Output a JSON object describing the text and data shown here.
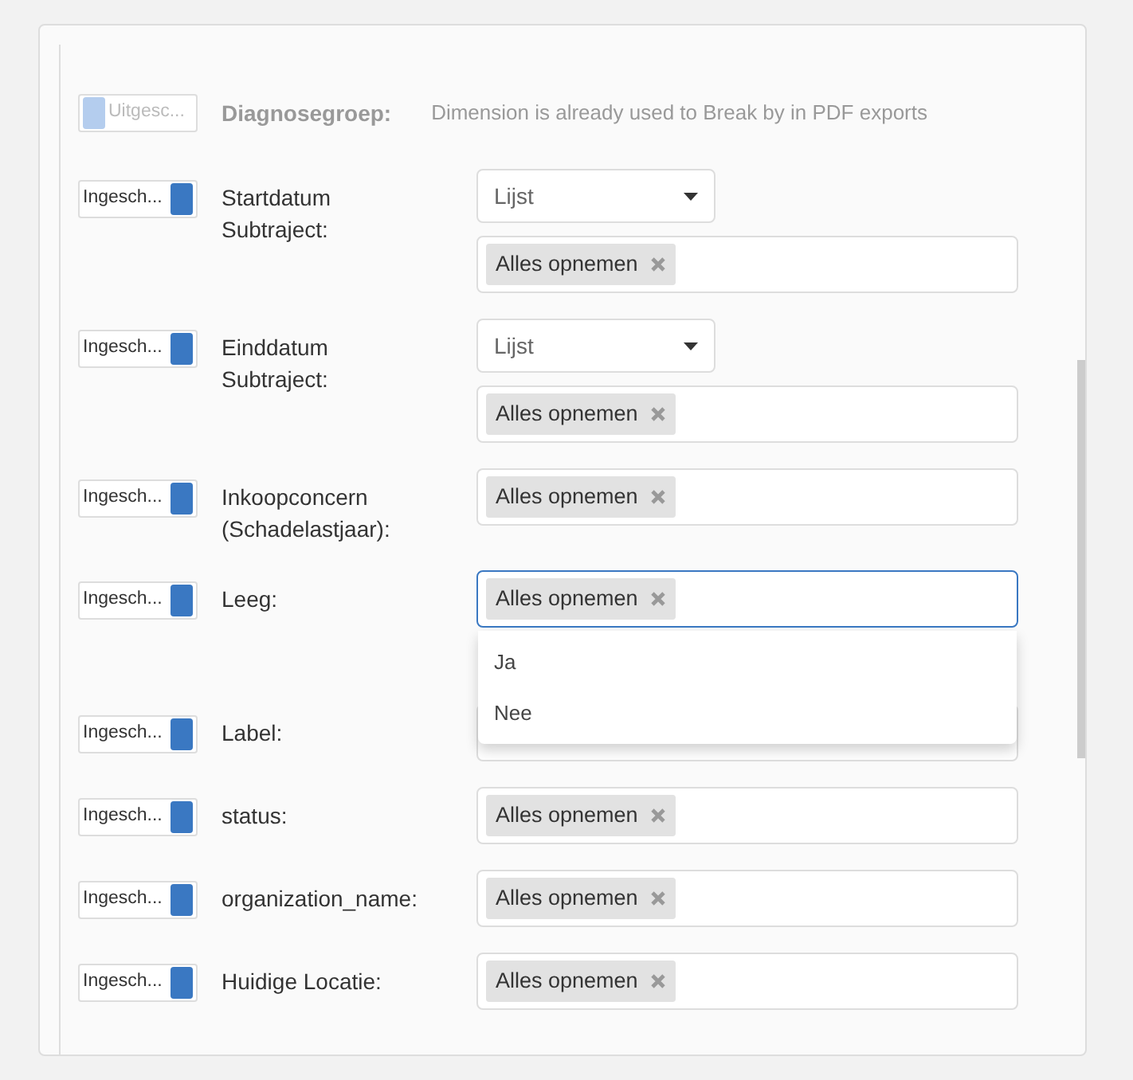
{
  "rows": [
    {
      "toggle": {
        "text": "Uitgesc...",
        "on": false
      },
      "label": "Diagnosegroep:",
      "disabled": true,
      "note": "Dimension is already used to Break by in PDF exports"
    },
    {
      "toggle": {
        "text": "Ingesch...",
        "on": true
      },
      "label": "Startdatum Subtraject:",
      "disabled": false,
      "controls": [
        {
          "kind": "select",
          "value": "Lijst"
        },
        {
          "kind": "tags",
          "tags": [
            "Alles opnemen"
          ],
          "focused": false
        }
      ]
    },
    {
      "toggle": {
        "text": "Ingesch...",
        "on": true
      },
      "label": "Einddatum Subtraject:",
      "disabled": false,
      "controls": [
        {
          "kind": "select",
          "value": "Lijst"
        },
        {
          "kind": "tags",
          "tags": [
            "Alles opnemen"
          ],
          "focused": false
        }
      ]
    },
    {
      "toggle": {
        "text": "Ingesch...",
        "on": true
      },
      "label": "Inkoopconcern (Schadelastjaar):",
      "disabled": false,
      "controls": [
        {
          "kind": "tags",
          "tags": [
            "Alles opnemen"
          ],
          "focused": false
        }
      ]
    },
    {
      "toggle": {
        "text": "Ingesch...",
        "on": true
      },
      "label": "Leeg:",
      "disabled": false,
      "controls": [
        {
          "kind": "tags",
          "tags": [
            "Alles opnemen"
          ],
          "focused": true,
          "options": [
            "Ja",
            "Nee"
          ]
        }
      ]
    },
    {
      "toggle": {
        "text": "Ingesch...",
        "on": true
      },
      "label": "Label:",
      "disabled": false,
      "controls": [
        {
          "kind": "tags",
          "focused": false
        }
      ]
    },
    {
      "toggle": {
        "text": "Ingesch...",
        "on": true
      },
      "label": "status:",
      "disabled": false,
      "controls": [
        {
          "kind": "tags",
          "tags": [
            "Alles opnemen"
          ],
          "focused": false
        }
      ]
    },
    {
      "toggle": {
        "text": "Ingesch...",
        "on": true
      },
      "label": "organization_name:",
      "disabled": false,
      "controls": [
        {
          "kind": "tags",
          "tags": [
            "Alles opnemen"
          ],
          "focused": false
        }
      ]
    },
    {
      "toggle": {
        "text": "Ingesch...",
        "on": true
      },
      "label": "Huidige Locatie:",
      "disabled": false,
      "controls": [
        {
          "kind": "tags",
          "tags": [
            "Alles opnemen"
          ],
          "focused": false
        }
      ]
    }
  ]
}
